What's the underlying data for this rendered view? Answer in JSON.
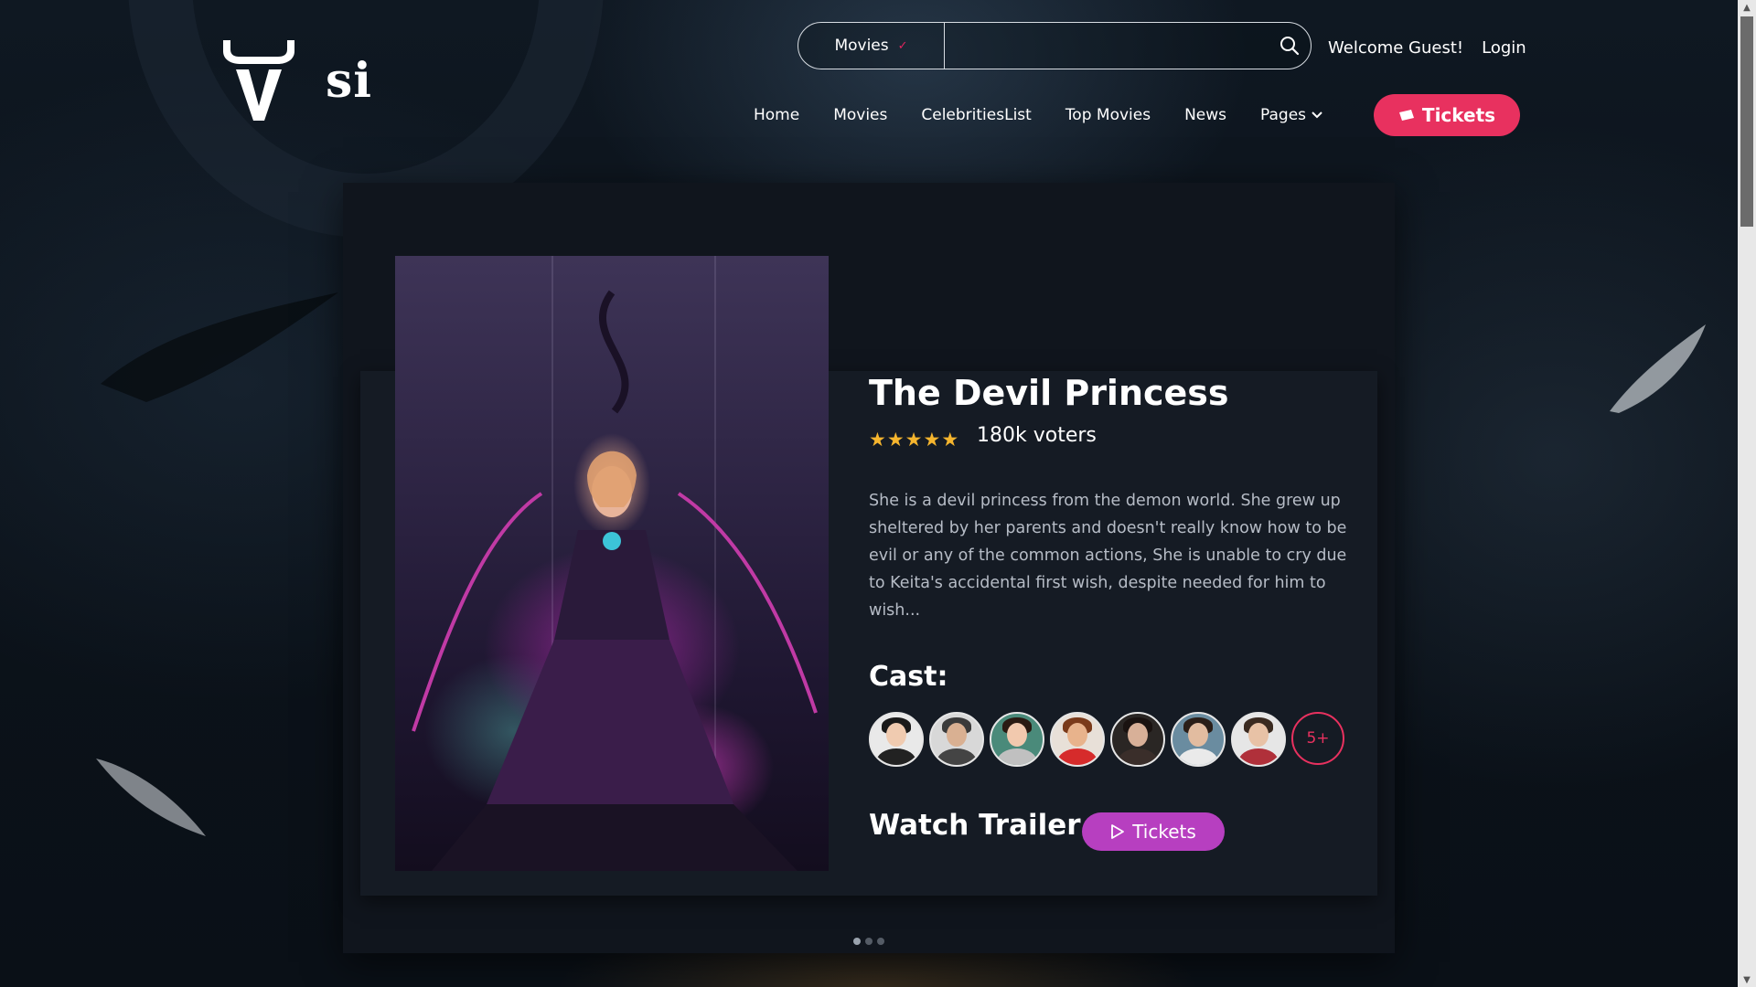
{
  "brand": {
    "logo_text": "si"
  },
  "search": {
    "category": "Movies",
    "placeholder": "",
    "value": ""
  },
  "user": {
    "welcome": "Welcome Guest!",
    "login": "Login"
  },
  "nav": {
    "items": [
      {
        "label": "Home"
      },
      {
        "label": "Movies"
      },
      {
        "label": "CelebritiesList"
      },
      {
        "label": "Top Movies"
      },
      {
        "label": "News"
      },
      {
        "label": "Pages"
      }
    ],
    "tickets_label": "Tickets"
  },
  "movie": {
    "title": "The Devil Princess",
    "rating": 5,
    "voters": "180k voters",
    "description": "She is a devil princess from the demon world. She grew up sheltered by her parents and doesn't really know how to be evil or any of the common actions, She is unable to cry due to Keita's accidental first wish, despite needed for him to wish...",
    "cast_title": "Cast:",
    "cast_more": "5+",
    "watch_trailer": "Watch Trailer",
    "trailer_button": "Tickets"
  },
  "carousel": {
    "count": 3,
    "active": 0
  },
  "colors": {
    "accent": "#e8315f",
    "trailer": "#b73fc0",
    "star": "#f5b52e",
    "card": "#10151d"
  }
}
